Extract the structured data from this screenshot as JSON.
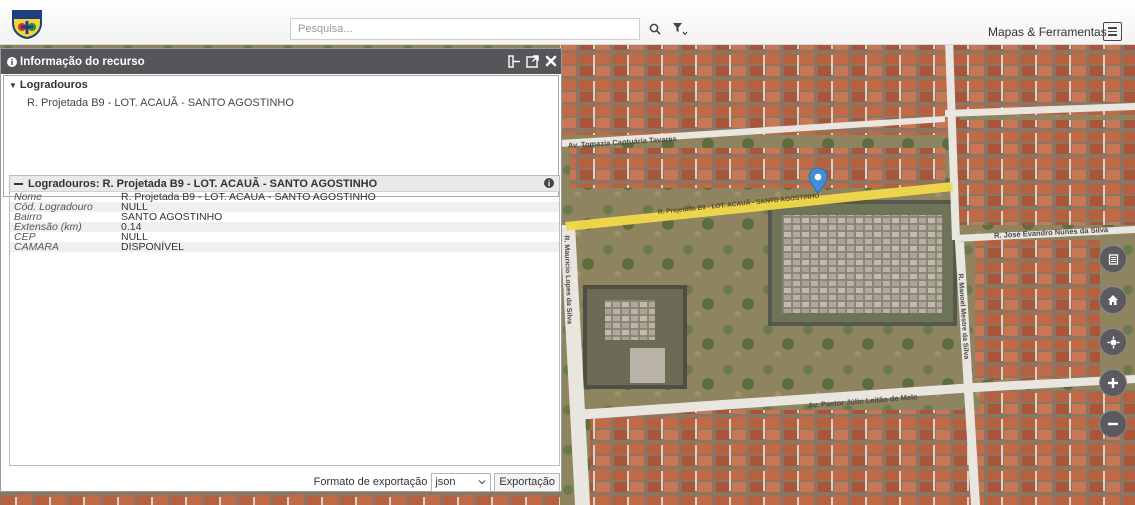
{
  "header": {
    "search_placeholder": "Pesquisa...",
    "tools_label": "Mapas & Ferramentas"
  },
  "panel": {
    "title": "Informação do recurso",
    "tree": {
      "group_label": "Logradouros",
      "item_label": "R. Projetada B9 - LOT. ACAUÃ - SANTO AGOSTINHO"
    },
    "detail": {
      "title": "Logradouros: R. Projetada B9 - LOT. ACAUÃ - SANTO AGOSTINHO",
      "rows": [
        {
          "key": "Nome",
          "value": "R. Projetada B9 - LOT. ACAUÃ - SANTO AGOSTINHO"
        },
        {
          "key": "Cód. Logradouro",
          "value": "NULL"
        },
        {
          "key": "Bairro",
          "value": "SANTO AGOSTINHO"
        },
        {
          "key": "Extensão (km)",
          "value": "0.14"
        },
        {
          "key": "CEP",
          "value": "NULL"
        },
        {
          "key": "CAMARA",
          "value": "DISPONÍVEL"
        }
      ]
    },
    "export": {
      "label": "Formato de exportação",
      "selected_format": "json",
      "button_label": "Exportação"
    }
  },
  "map": {
    "street_labels": {
      "av_tomazia": "Av. Tomazia Cantuária Tavares",
      "r_projetada": "R. Projetada B9 - LOT. ACAUÃ - SANTO AGOSTINHO",
      "r_jose": "R. José Evandro Nunes da Silva",
      "r_mauricio": "R. Mauricio Lopes da Silva",
      "r_manoel": "R. Manoel Mestre da Silva",
      "av_pastor": "Av. Pastor Júlio Leitão de Melo"
    },
    "highlight_color": "#f2d94a",
    "marker_color": "#3f8ed6"
  },
  "controls": [
    "legend-icon",
    "home-icon",
    "locate-icon",
    "zoom-in-icon",
    "zoom-out-icon"
  ]
}
